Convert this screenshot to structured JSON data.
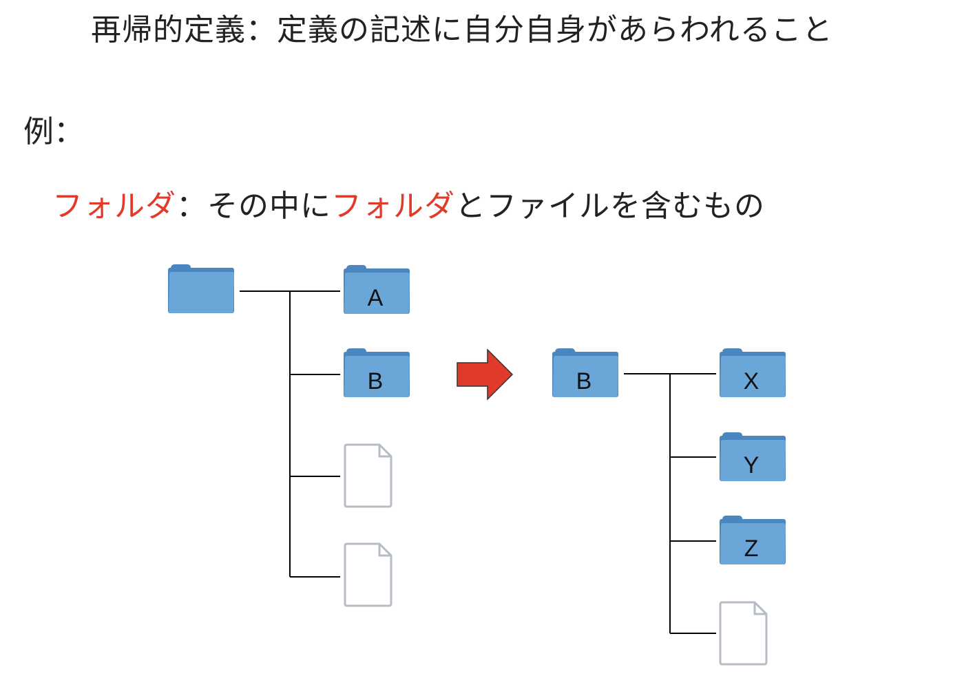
{
  "title": "再帰的定義：定義の記述に自分自身があらわれること",
  "example_label": "例：",
  "definition": {
    "term": "フォルダ",
    "separator": "：",
    "middle": "その中に",
    "term_repeat": "フォルダ",
    "rest": "とファイルを含むもの"
  },
  "left_tree": {
    "children": [
      {
        "type": "folder",
        "label": "A"
      },
      {
        "type": "folder",
        "label": "B"
      },
      {
        "type": "file",
        "label": ""
      },
      {
        "type": "file",
        "label": ""
      }
    ]
  },
  "right_tree": {
    "root_label": "B",
    "children": [
      {
        "type": "folder",
        "label": "X"
      },
      {
        "type": "folder",
        "label": "Y"
      },
      {
        "type": "folder",
        "label": "Z"
      },
      {
        "type": "file",
        "label": ""
      }
    ]
  },
  "colors": {
    "folder_body": "#6aa6d8",
    "folder_tab": "#4a86bf",
    "file_stroke": "#b5bcc5",
    "arrow": "#e23a2a",
    "highlight_text": "#e23a2a",
    "line": "#000000"
  }
}
